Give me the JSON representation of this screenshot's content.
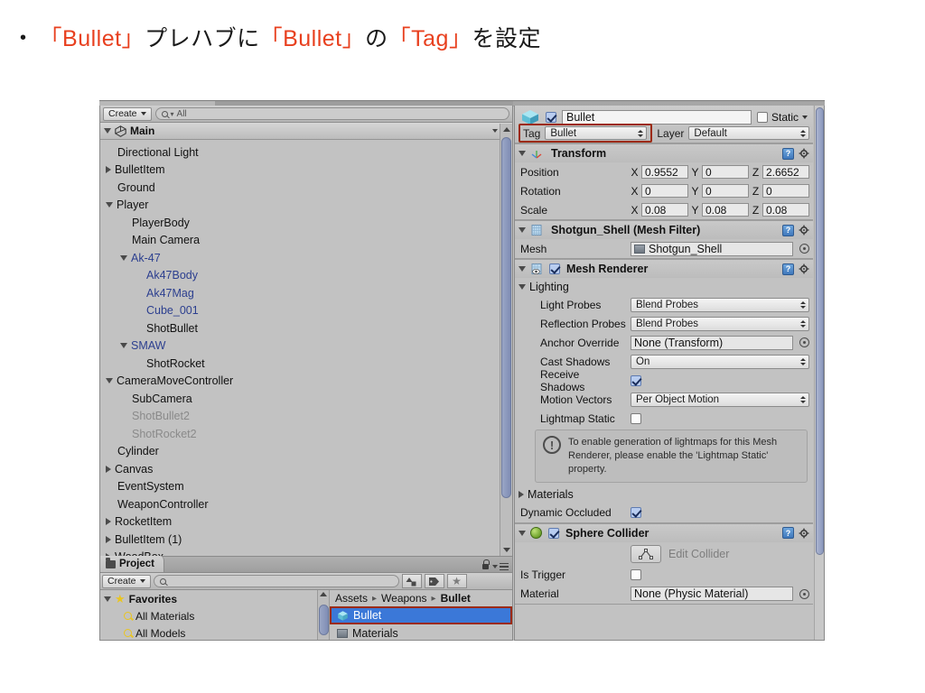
{
  "slide": {
    "bullet_marker": "•",
    "parts": [
      {
        "t": "「Bullet」",
        "hl": true
      },
      {
        "t": "プレハブに",
        "hl": false
      },
      {
        "t": "「Bullet」",
        "hl": true
      },
      {
        "t": "の",
        "hl": false
      },
      {
        "t": "「Tag」",
        "hl": true
      },
      {
        "t": "を設定",
        "hl": false
      }
    ],
    "accent_color": "#e8401f"
  },
  "hierarchy": {
    "create_label": "Create",
    "search_placeholder": "All",
    "search_value": "",
    "title": "Main",
    "items": [
      {
        "label": "Directional Light",
        "indent": 1,
        "arrow": "none",
        "style": "normal"
      },
      {
        "label": "BulletItem",
        "indent": 1,
        "arrow": "right",
        "style": "normal"
      },
      {
        "label": "Ground",
        "indent": 1,
        "arrow": "none",
        "style": "normal"
      },
      {
        "label": "Player",
        "indent": 1,
        "arrow": "down",
        "style": "normal"
      },
      {
        "label": "PlayerBody",
        "indent": 2,
        "arrow": "none",
        "style": "normal"
      },
      {
        "label": "Main Camera",
        "indent": 2,
        "arrow": "none",
        "style": "normal"
      },
      {
        "label": "Ak-47",
        "indent": 2,
        "arrow": "down",
        "style": "prefab"
      },
      {
        "label": "Ak47Body",
        "indent": 3,
        "arrow": "none",
        "style": "prefab"
      },
      {
        "label": "Ak47Mag",
        "indent": 3,
        "arrow": "none",
        "style": "prefab"
      },
      {
        "label": "Cube_001",
        "indent": 3,
        "arrow": "none",
        "style": "prefab"
      },
      {
        "label": "ShotBullet",
        "indent": 3,
        "arrow": "none",
        "style": "normal"
      },
      {
        "label": "SMAW",
        "indent": 2,
        "arrow": "down",
        "style": "prefab"
      },
      {
        "label": "ShotRocket",
        "indent": 3,
        "arrow": "none",
        "style": "normal"
      },
      {
        "label": "CameraMoveController",
        "indent": 1,
        "arrow": "down",
        "style": "normal"
      },
      {
        "label": "SubCamera",
        "indent": 2,
        "arrow": "none",
        "style": "normal"
      },
      {
        "label": "ShotBullet2",
        "indent": 2,
        "arrow": "none",
        "style": "dim"
      },
      {
        "label": "ShotRocket2",
        "indent": 2,
        "arrow": "none",
        "style": "dim"
      },
      {
        "label": "Cylinder",
        "indent": 1,
        "arrow": "none",
        "style": "normal"
      },
      {
        "label": "Canvas",
        "indent": 1,
        "arrow": "right",
        "style": "normal"
      },
      {
        "label": "EventSystem",
        "indent": 1,
        "arrow": "none",
        "style": "normal"
      },
      {
        "label": "WeaponController",
        "indent": 1,
        "arrow": "none",
        "style": "normal"
      },
      {
        "label": "RocketItem",
        "indent": 1,
        "arrow": "right",
        "style": "normal"
      },
      {
        "label": "BulletItem (1)",
        "indent": 1,
        "arrow": "right",
        "style": "normal"
      },
      {
        "label": "WoodBox",
        "indent": 1,
        "arrow": "right",
        "style": "normal"
      }
    ]
  },
  "project": {
    "tab_label": "Project",
    "create_label": "Create",
    "search_placeholder": "",
    "favorites_label": "Favorites",
    "favorites": [
      {
        "label": "All Materials"
      },
      {
        "label": "All Models"
      }
    ],
    "breadcrumb": [
      "Assets",
      "Weapons",
      "Bullet"
    ],
    "assets": [
      {
        "label": "Bullet",
        "icon": "prefab-cube-icon",
        "selected": true
      },
      {
        "label": "Materials",
        "icon": "folder-icon",
        "selected": false
      }
    ]
  },
  "inspector": {
    "object_name": "Bullet",
    "object_enabled": true,
    "static_label": "Static",
    "static_checked": false,
    "tag_label": "Tag",
    "tag_value": "Bullet",
    "layer_label": "Layer",
    "layer_value": "Default",
    "tag_highlight_color": "#9c2a10",
    "transform": {
      "title": "Transform",
      "rows": [
        {
          "name": "Position",
          "x": "0.9552",
          "y": "0",
          "z": "2.6652"
        },
        {
          "name": "Rotation",
          "x": "0",
          "y": "0",
          "z": "0"
        },
        {
          "name": "Scale",
          "x": "0.08",
          "y": "0.08",
          "z": "0.08"
        }
      ]
    },
    "mesh_filter": {
      "title": "Shotgun_Shell (Mesh Filter)",
      "mesh_label": "Mesh",
      "mesh_value": "Shotgun_Shell"
    },
    "mesh_renderer": {
      "title": "Mesh Renderer",
      "enabled": true,
      "lighting_label": "Lighting",
      "light_probes_label": "Light Probes",
      "light_probes_value": "Blend Probes",
      "reflection_probes_label": "Reflection Probes",
      "reflection_probes_value": "Blend Probes",
      "anchor_override_label": "Anchor Override",
      "anchor_override_value": "None (Transform)",
      "cast_shadows_label": "Cast Shadows",
      "cast_shadows_value": "On",
      "receive_shadows_label": "Receive Shadows",
      "receive_shadows_checked": true,
      "motion_vectors_label": "Motion Vectors",
      "motion_vectors_value": "Per Object Motion",
      "lightmap_static_label": "Lightmap Static",
      "lightmap_static_checked": false,
      "help_text": "To enable generation of lightmaps for this Mesh Renderer, please enable the 'Lightmap Static' property.",
      "materials_label": "Materials",
      "dynamic_occluded_label": "Dynamic Occluded",
      "dynamic_occluded_checked": true
    },
    "sphere_collider": {
      "title": "Sphere Collider",
      "enabled": true,
      "edit_collider_label": "Edit Collider",
      "is_trigger_label": "Is Trigger",
      "is_trigger_checked": false,
      "material_label": "Material",
      "material_value": "None (Physic Material)"
    }
  }
}
